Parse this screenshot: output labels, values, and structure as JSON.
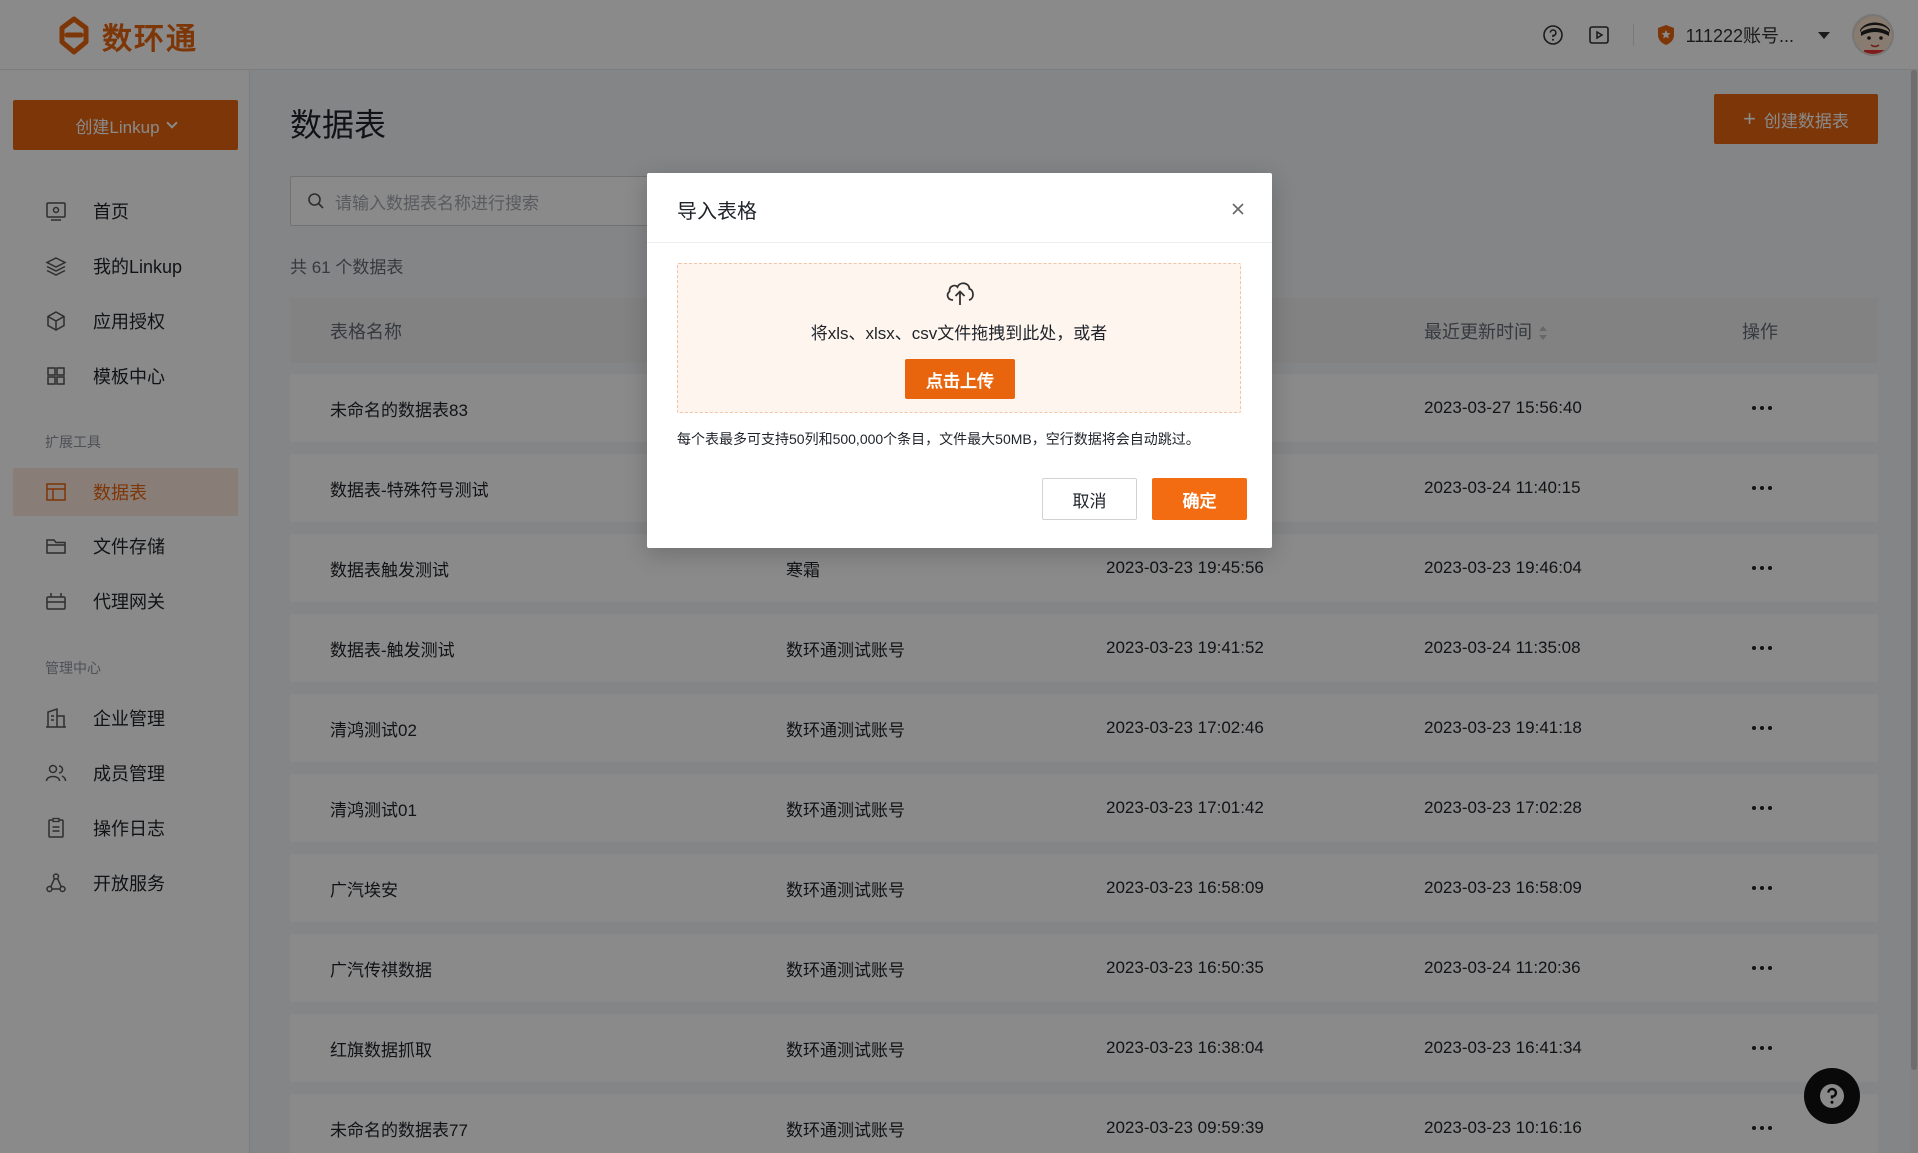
{
  "app": {
    "brand": "数环通"
  },
  "header": {
    "account_name": "111222账号..."
  },
  "sidebar": {
    "create_button": "创建Linkup",
    "items": [
      {
        "label": "首页",
        "icon": "home-monitor-icon"
      },
      {
        "label": "我的Linkup",
        "icon": "layers-icon"
      },
      {
        "label": "应用授权",
        "icon": "cube-icon"
      },
      {
        "label": "模板中心",
        "icon": "grid-icon"
      }
    ],
    "section_tools": "扩展工具",
    "tools": [
      {
        "label": "数据表",
        "icon": "table-icon",
        "active": true
      },
      {
        "label": "文件存储",
        "icon": "folder-icon"
      },
      {
        "label": "代理网关",
        "icon": "gateway-icon"
      }
    ],
    "section_admin": "管理中心",
    "admin": [
      {
        "label": "企业管理",
        "icon": "building-icon"
      },
      {
        "label": "成员管理",
        "icon": "users-icon"
      },
      {
        "label": "操作日志",
        "icon": "clipboard-icon"
      },
      {
        "label": "开放服务",
        "icon": "share-nodes-icon"
      }
    ]
  },
  "main": {
    "title": "数据表",
    "create_button": "创建数据表",
    "search_placeholder": "请输入数据表名称进行搜索",
    "total": "共 61 个数据表",
    "columns": {
      "name": "表格名称",
      "updated": "最近更新时间",
      "actions": "操作"
    },
    "rows": [
      {
        "name": "未命名的数据表83",
        "creator": "",
        "created": "",
        "updated": "2023-03-27 15:56:40"
      },
      {
        "name": "数据表-特殊符号测试",
        "creator": "",
        "created": "",
        "updated": "2023-03-24 11:40:15"
      },
      {
        "name": "数据表触发测试",
        "creator": "寒霜",
        "created": "2023-03-23 19:45:56",
        "updated": "2023-03-23 19:46:04"
      },
      {
        "name": "数据表-触发测试",
        "creator": "数环通测试账号",
        "created": "2023-03-23 19:41:52",
        "updated": "2023-03-24 11:35:08"
      },
      {
        "name": "清鸿测试02",
        "creator": "数环通测试账号",
        "created": "2023-03-23 17:02:46",
        "updated": "2023-03-23 19:41:18"
      },
      {
        "name": "清鸿测试01",
        "creator": "数环通测试账号",
        "created": "2023-03-23 17:01:42",
        "updated": "2023-03-23 17:02:28"
      },
      {
        "name": "广汽埃安",
        "creator": "数环通测试账号",
        "created": "2023-03-23 16:58:09",
        "updated": "2023-03-23 16:58:09"
      },
      {
        "name": "广汽传祺数据",
        "creator": "数环通测试账号",
        "created": "2023-03-23 16:50:35",
        "updated": "2023-03-24 11:20:36"
      },
      {
        "name": "红旗数据抓取",
        "creator": "数环通测试账号",
        "created": "2023-03-23 16:38:04",
        "updated": "2023-03-23 16:41:34"
      },
      {
        "name": "未命名的数据表77",
        "creator": "数环通测试账号",
        "created": "2023-03-23 09:59:39",
        "updated": "2023-03-23 10:16:16"
      }
    ]
  },
  "modal": {
    "title": "导入表格",
    "drop_text": "将xls、xlsx、csv文件拖拽到此处，或者",
    "upload_button": "点击上传",
    "note": "每个表最多可支持50列和500,000个条目，文件最大50MB，空行数据将会自动跳过。",
    "cancel": "取消",
    "confirm": "确定"
  },
  "colors": {
    "brand": "#e8650d",
    "active_bg": "#fde9dc",
    "dropzone_bg": "#fef5ef"
  }
}
